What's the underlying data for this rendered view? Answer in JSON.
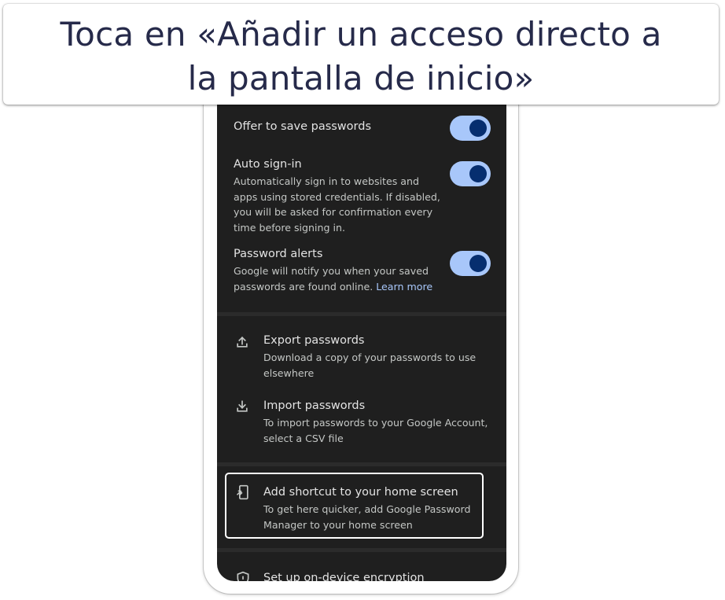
{
  "banner": {
    "line1": "Toca en «Añadir un acceso directo a",
    "line2": "la pantalla de inicio»"
  },
  "settings": {
    "offer_save": {
      "title": "Offer to save passwords",
      "enabled": true
    },
    "auto_signin": {
      "title": "Auto sign-in",
      "desc_lines": [
        "Automatically sign in to websites and",
        "apps using stored credentials. If disabled,",
        "you will be asked for confirmation every",
        "time before signing in."
      ],
      "enabled": true
    },
    "password_alerts": {
      "title": "Password alerts",
      "desc_line1": "Google will notify you when your saved",
      "desc_line2": "passwords are found online.",
      "link": "Learn more",
      "enabled": true
    }
  },
  "actions": {
    "export": {
      "icon": "upload-icon",
      "title": "Export passwords",
      "desc_lines": [
        "Download a copy of your passwords to use",
        "elsewhere"
      ]
    },
    "import": {
      "icon": "download-icon",
      "title": "Import passwords",
      "desc_lines": [
        "To import passwords to your Google Account,",
        "select a CSV file"
      ]
    },
    "shortcut": {
      "icon": "add-to-home-screen-icon",
      "title": "Add shortcut to your home screen",
      "desc_lines": [
        "To get here quicker, add Google Password",
        "Manager to your home screen"
      ]
    },
    "encryption": {
      "icon": "shield-icon",
      "title": "Set up on-device encryption"
    }
  },
  "colors": {
    "toggle_track": "#a8c7fa",
    "toggle_knob": "#062e6f",
    "link": "#a8c7fa",
    "screen_bg": "#1f1f1f",
    "banner_text": "#262a4a"
  }
}
